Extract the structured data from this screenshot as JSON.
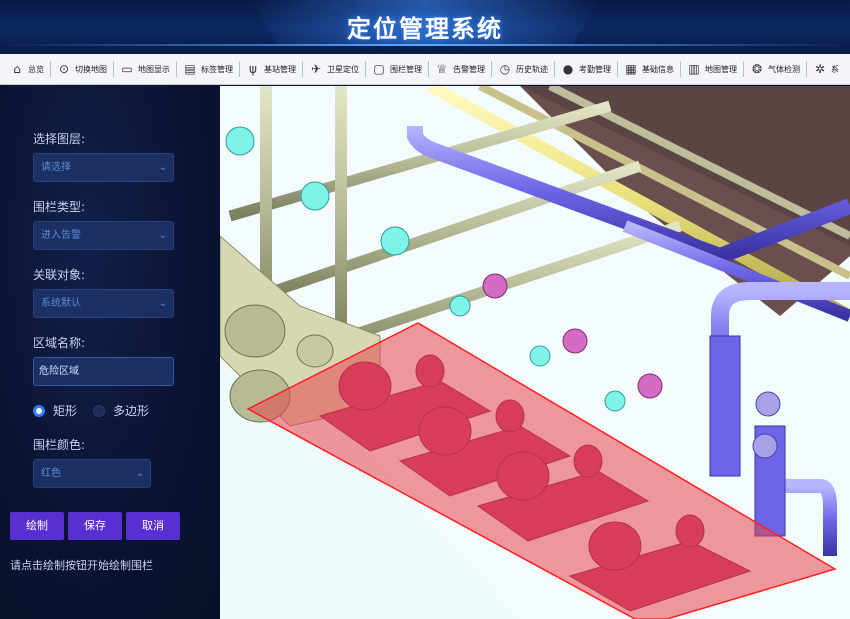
{
  "app": {
    "title": "定位管理系统"
  },
  "nav": [
    {
      "label": "总览",
      "icon": "home-icon",
      "glyph": "⌂"
    },
    {
      "label": "切换地图",
      "icon": "map-pin-icon",
      "glyph": "⊙"
    },
    {
      "label": "地图显示",
      "icon": "monitor-icon",
      "glyph": "▭"
    },
    {
      "label": "标签管理",
      "icon": "tag-list-icon",
      "glyph": "▤"
    },
    {
      "label": "基站管理",
      "icon": "antenna-icon",
      "glyph": "ψ"
    },
    {
      "label": "卫星定位",
      "icon": "satellite-icon",
      "glyph": "✈"
    },
    {
      "label": "围栏管理",
      "icon": "fence-icon",
      "glyph": "▢"
    },
    {
      "label": "告警管理",
      "icon": "alarm-icon",
      "glyph": "♕"
    },
    {
      "label": "历史轨迹",
      "icon": "history-icon",
      "glyph": "◷"
    },
    {
      "label": "考勤管理",
      "icon": "attendance-icon",
      "glyph": "●"
    },
    {
      "label": "基础信息",
      "icon": "info-doc-icon",
      "glyph": "▦"
    },
    {
      "label": "地图管理",
      "icon": "book-map-icon",
      "glyph": "▥"
    },
    {
      "label": "气体检测",
      "icon": "gas-detect-icon",
      "glyph": "❂"
    },
    {
      "label": "系",
      "icon": "gear-icon",
      "glyph": "✲"
    }
  ],
  "form": {
    "layer_label": "选择图层:",
    "layer_value": "请选择",
    "fence_type_label": "围栏类型:",
    "fence_type_value": "进入告警",
    "related_label": "关联对象:",
    "related_value": "系统默认",
    "area_name_label": "区域名称:",
    "area_name_value": "危险区域",
    "shape_rect": "矩形",
    "shape_poly": "多边形",
    "shape_selected": "矩形",
    "color_label": "围栏颜色:",
    "color_value": "红色"
  },
  "buttons": {
    "draw": "绘制",
    "save": "保存",
    "cancel": "取消"
  },
  "hint": "请点击绘制按钮开始绘制围栏",
  "colors": {
    "accent": "#5a2fd1",
    "fence_fill": "#e8434a",
    "fence_stroke": "#ff1f1f"
  }
}
